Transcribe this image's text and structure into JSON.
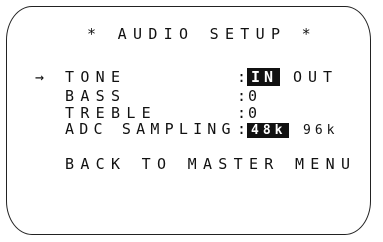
{
  "screen": {
    "title": "* AUDIO SETUP *",
    "cursor_icon": "right-arrow-icon",
    "cursor_glyph": "→",
    "rows": [
      {
        "label": "TONE",
        "separator": ":",
        "options": [
          "IN",
          "OUT"
        ],
        "selected": "IN"
      },
      {
        "label": "BASS",
        "separator": ":",
        "value": "0"
      },
      {
        "label": "TREBLE",
        "separator": ":",
        "value": "0"
      },
      {
        "label": "ADC SAMPLING",
        "separator": ":",
        "options": [
          "48k",
          "96k"
        ],
        "selected": "48k"
      }
    ],
    "back_label": "BACK TO MASTER MENU"
  }
}
